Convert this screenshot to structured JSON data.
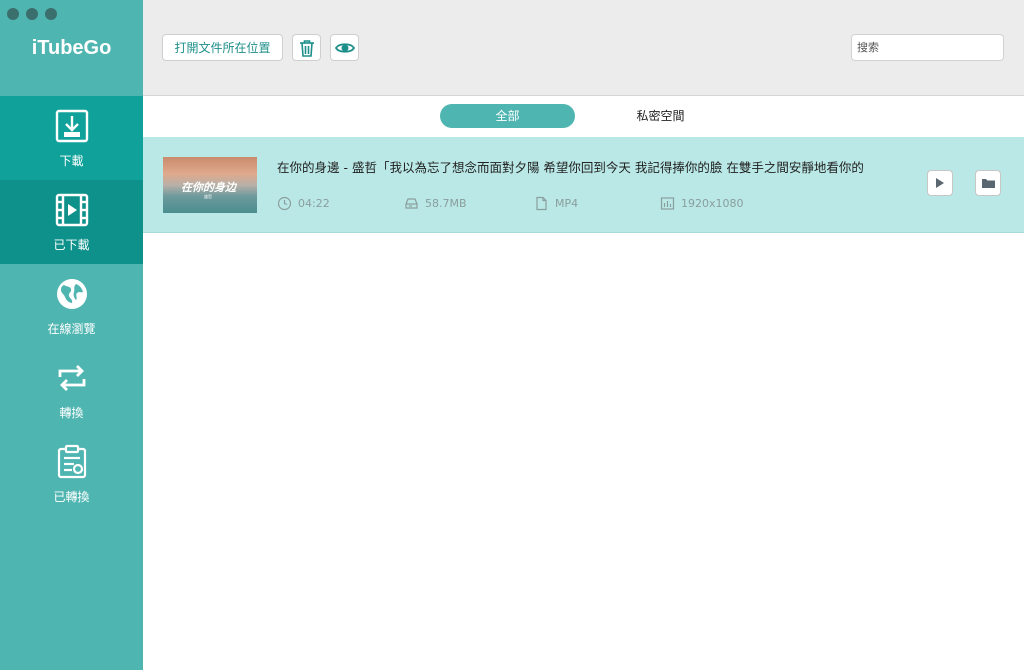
{
  "app": {
    "title": "iTubeGo"
  },
  "sidebar": {
    "items": [
      {
        "label": "下載",
        "icon": "download-icon"
      },
      {
        "label": "已下載",
        "icon": "film-icon"
      },
      {
        "label": "在線瀏覽",
        "icon": "globe-icon"
      },
      {
        "label": "轉換",
        "icon": "convert-icon"
      },
      {
        "label": "已轉換",
        "icon": "converted-list-icon"
      }
    ],
    "selected": "已下載"
  },
  "toolbar": {
    "open_location_label": "打開文件所在位置",
    "delete_icon": "trash-icon",
    "preview_icon": "eye-icon",
    "search_placeholder": "搜索"
  },
  "tabs": [
    {
      "label": "全部",
      "active": true
    },
    {
      "label": "私密空間",
      "active": false
    }
  ],
  "items": [
    {
      "title": "在你的身邊 - 盛哲「我以為忘了想念而面對夕陽 希望你回到今天 我記得捧你的臉 在雙手之間安靜地看你的",
      "thumbnail_text": "在你的身边",
      "thumbnail_subtext": "盛哲",
      "duration": "04:22",
      "size": "58.7MB",
      "format": "MP4",
      "resolution": "1920x1080"
    }
  ],
  "colors": {
    "sidebar": "#4fb5b0",
    "sidebar_selected": "#0e918a",
    "row_highlight": "#b9e8e6",
    "accent": "#1d8f8a"
  }
}
